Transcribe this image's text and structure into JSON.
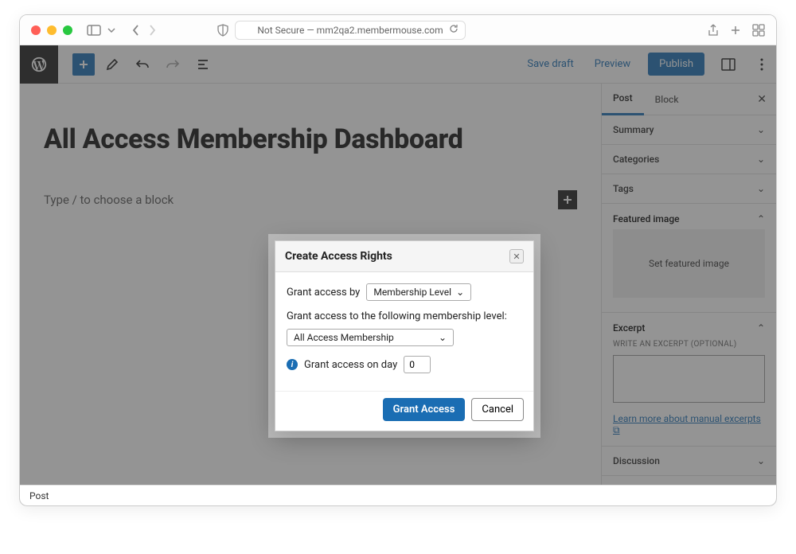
{
  "browser": {
    "url_prefix": "Not Secure —",
    "url": "mm2qa2.membermouse.com"
  },
  "toolbar": {
    "save_draft": "Save draft",
    "preview": "Preview",
    "publish": "Publish"
  },
  "editor": {
    "page_title": "All Access Membership Dashboard",
    "block_placeholder": "Type / to choose a block"
  },
  "sidebar": {
    "tab_post": "Post",
    "tab_block": "Block",
    "summary": "Summary",
    "categories": "Categories",
    "tags": "Tags",
    "featured_image": "Featured image",
    "set_featured": "Set featured image",
    "excerpt": "Excerpt",
    "excerpt_label": "WRITE AN EXCERPT (OPTIONAL)",
    "excerpt_link": "Learn more about manual excerpts",
    "discussion": "Discussion"
  },
  "modal": {
    "title": "Create Access Rights",
    "grant_by_label": "Grant access by",
    "grant_by_value": "Membership Level",
    "field_label": "Grant access to the following membership level:",
    "level_value": "All Access Membership",
    "day_label": "Grant access on day",
    "day_value": "0",
    "grant_btn": "Grant Access",
    "cancel_btn": "Cancel"
  },
  "footer": {
    "breadcrumb": "Post"
  }
}
